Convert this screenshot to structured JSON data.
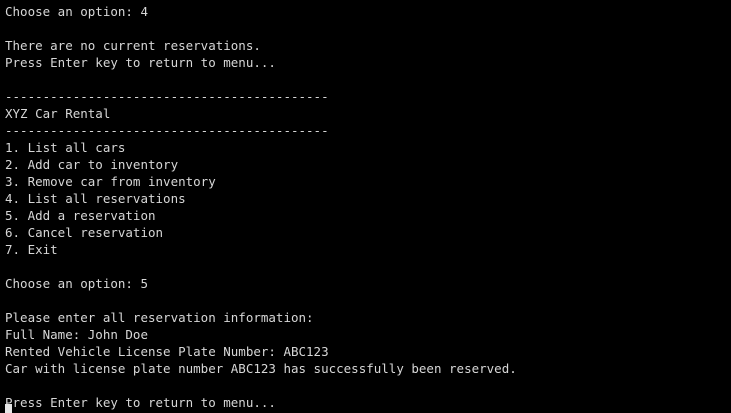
{
  "terminal": {
    "lines": [
      "Choose an option: 4",
      "",
      "There are no current reservations.",
      "Press Enter key to return to menu...",
      "",
      "-------------------------------------------",
      "XYZ Car Rental",
      "-------------------------------------------",
      "1. List all cars",
      "2. Add car to inventory",
      "3. Remove car from inventory",
      "4. List all reservations",
      "5. Add a reservation",
      "6. Cancel reservation",
      "7. Exit",
      "",
      "Choose an option: 5",
      "",
      "Please enter all reservation information:",
      "Full Name: John Doe",
      "Rented Vehicle License Plate Number: ABC123",
      "Car with license plate number ABC123 has successfully been reserved.",
      "",
      "Press Enter key to return to menu..."
    ]
  },
  "colors": {
    "background": "#000000",
    "text": "#d7d7d7",
    "cursor": "#e6e6e6"
  }
}
